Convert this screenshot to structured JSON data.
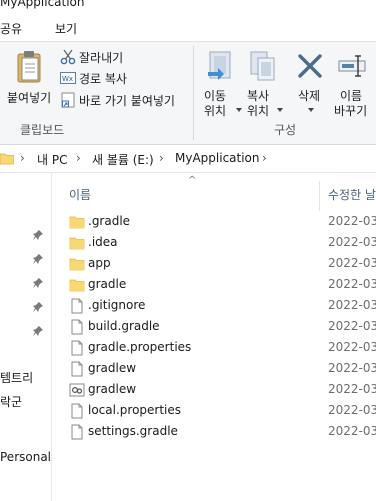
{
  "window": {
    "title": "MyApplication"
  },
  "ribbon_tabs": [
    {
      "label": "공유"
    },
    {
      "label": "보기"
    }
  ],
  "ribbon": {
    "clipboard": {
      "paste_label": "붙여넣기",
      "cut_label": "잘라내기",
      "copy_path_label": "경로 복사",
      "paste_shortcut_label": "바로 가기 붙여넣기",
      "group_label": "클립보드"
    },
    "organize": {
      "move_to_line1": "이동",
      "move_to_line2": "위치",
      "copy_to_line1": "복사",
      "copy_to_line2": "위치",
      "delete_label": "삭제",
      "rename_line1": "이름",
      "rename_line2": "바꾸기",
      "group_label": "구성"
    }
  },
  "address_bar": {
    "crumbs": [
      "내 PC",
      "새 볼륨 (E:)",
      "MyApplication"
    ]
  },
  "nav_pane": {
    "items": [
      "템트리",
      "락군",
      "Personal"
    ]
  },
  "file_list": {
    "columns": {
      "name": "이름",
      "modified": "수정한 날"
    },
    "rows": [
      {
        "name": ".gradle",
        "type": "folder",
        "date": "2022-03"
      },
      {
        "name": ".idea",
        "type": "folder",
        "date": "2022-03"
      },
      {
        "name": "app",
        "type": "folder",
        "date": "2022-03"
      },
      {
        "name": "gradle",
        "type": "folder",
        "date": "2022-03"
      },
      {
        "name": ".gitignore",
        "type": "file",
        "date": "2022-03"
      },
      {
        "name": "build.gradle",
        "type": "file",
        "date": "2022-03"
      },
      {
        "name": "gradle.properties",
        "type": "file",
        "date": "2022-03"
      },
      {
        "name": "gradlew",
        "type": "file",
        "date": "2022-03"
      },
      {
        "name": "gradlew",
        "type": "bat-file",
        "date": "2022-03"
      },
      {
        "name": "local.properties",
        "type": "file",
        "date": "2022-03"
      },
      {
        "name": "settings.gradle",
        "type": "file",
        "date": "2022-03"
      }
    ]
  },
  "colors": {
    "folder": "#f8d775",
    "folder_dark": "#e8b84a",
    "delete_x": "#4a6c8c",
    "header_text": "#4c607a"
  }
}
